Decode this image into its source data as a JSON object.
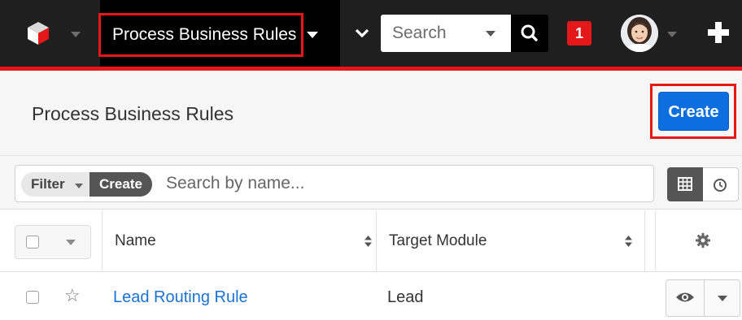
{
  "topbar": {
    "module_label": "Process Business Rules",
    "search_placeholder": "Search",
    "notification_count": "1",
    "icons": [
      "sugar-cube-logo-icon",
      "chevron-down-icon",
      "search-icon",
      "avatar",
      "plus-icon"
    ]
  },
  "header": {
    "title": "Process Business Rules",
    "create_label": "Create"
  },
  "filter": {
    "filter_label": "Filter",
    "create_label": "Create",
    "search_placeholder": "Search by name..."
  },
  "table": {
    "columns": [
      "Name",
      "Target Module"
    ],
    "rows": [
      {
        "name": "Lead Routing Rule",
        "target_module": "Lead"
      }
    ]
  },
  "colors": {
    "accent_red": "#e61718",
    "primary_blue": "#0d6ee0",
    "link_blue": "#1a73d4",
    "topbar_bg": "#1f1f1f"
  }
}
